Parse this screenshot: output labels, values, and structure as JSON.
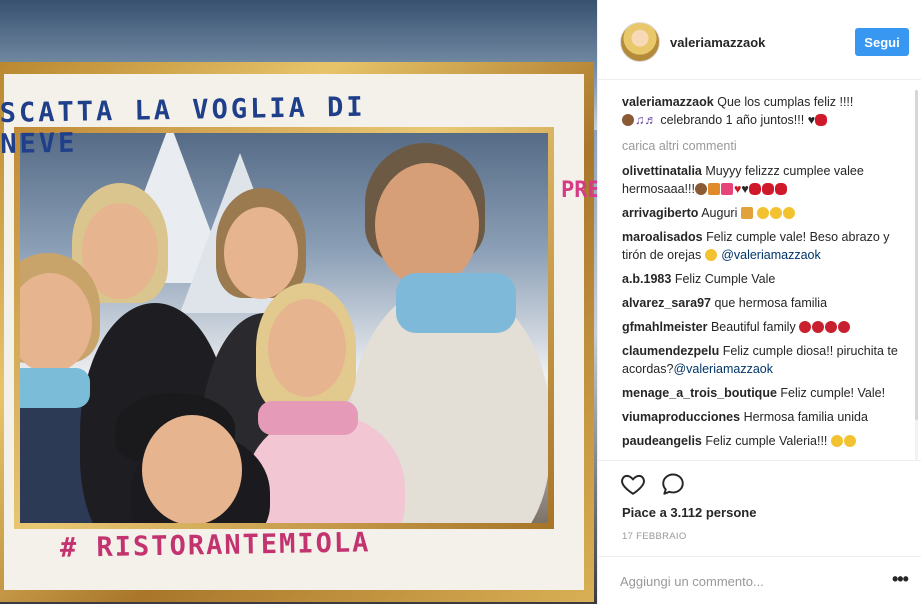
{
  "photo": {
    "sign_top": "SCATTA LA VOGLIA DI NEVE",
    "sign_side": "PREDAZZO",
    "sign_bottom": "# RISTORANTEMIOLA"
  },
  "header": {
    "username": "valeriamazzaok",
    "follow_label": "Segui"
  },
  "caption": {
    "user": "valeriamazzaok",
    "text_a": "Que los cumplas feliz !!!!",
    "text_b": "celebrando 1 año juntos!!!"
  },
  "load_more": "carica altri commenti",
  "comments": [
    {
      "user": "olivettinatalia",
      "text": "Muyyy felizzz cumplee valee hermosaaa!!!"
    },
    {
      "user": "arrivagiberto",
      "text": "Auguri"
    },
    {
      "user": "maroalisados",
      "text": "Feliz cumple vale! Beso abrazo y tirón de orejas",
      "mention": "@valeriamazzaok"
    },
    {
      "user": "a.b.1983",
      "text": "Feliz Cumple Vale"
    },
    {
      "user": "alvarez_sara97",
      "text": "que hermosa familia"
    },
    {
      "user": "gfmahlmeister",
      "text": "Beautiful family"
    },
    {
      "user": "claumendezpelu",
      "text": "Feliz cumple diosa!! piruchita te acordas?",
      "mention": "@valeriamazzaok"
    },
    {
      "user": "menage_a_trois_boutique",
      "text": "Feliz cumple! Vale!"
    },
    {
      "user": "viumaproducciones",
      "text": "Hermosa familia unida"
    },
    {
      "user": "paudeangelis",
      "text": "Feliz cumple Valeria!!!"
    }
  ],
  "actions": {
    "likes": "Piace a 3.112 persone",
    "date": "17 FEBBRAIO",
    "comment_placeholder": "Aggiungi un commento...",
    "more": "•••"
  },
  "icons": {
    "like": "heart-outline-icon",
    "comment": "speech-bubble-icon",
    "more": "more-options-icon"
  },
  "colors": {
    "follow_button": "#3897f0",
    "mention": "#003569",
    "secondary_text": "#999999"
  }
}
